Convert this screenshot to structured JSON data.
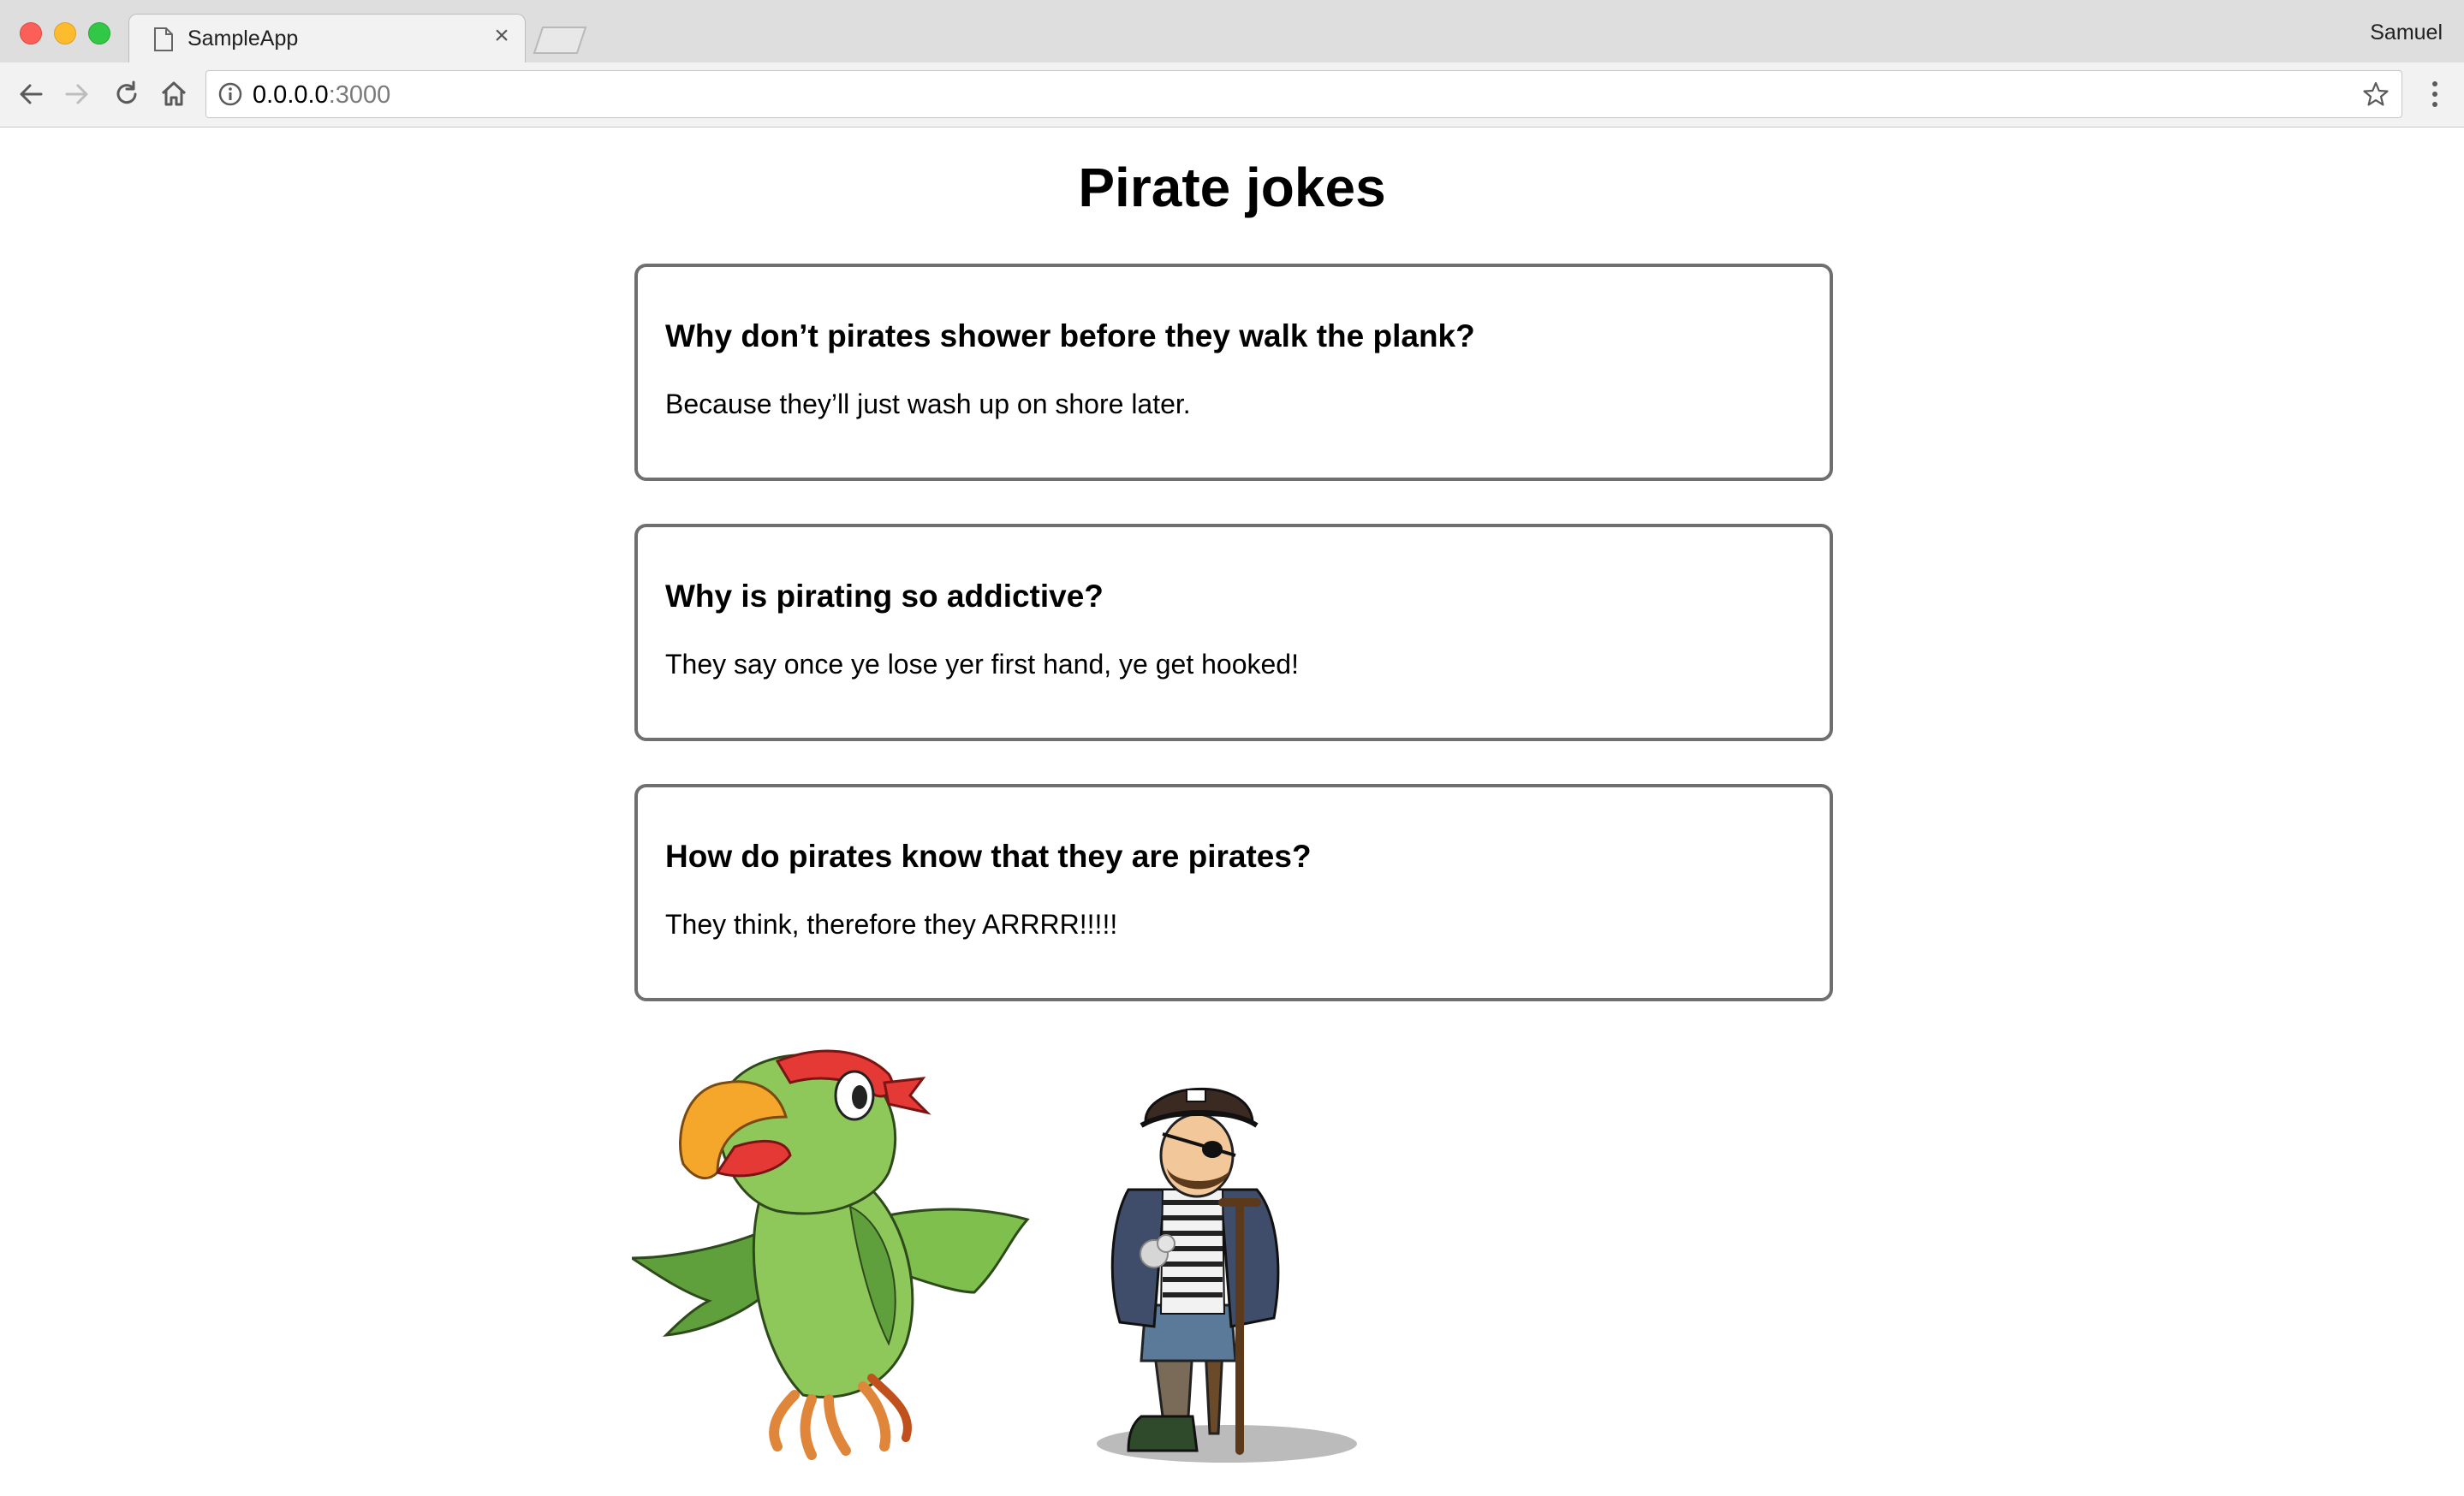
{
  "browser": {
    "tab_title": "SampleApp",
    "tab_close": "×",
    "profile_name": "Samuel",
    "url_host": "0.0.0.0",
    "url_port": ":3000"
  },
  "page": {
    "title": "Pirate jokes",
    "jokes": [
      {
        "question": "Why don’t pirates shower before they walk the plank?",
        "answer": "Because they’ll just wash up on shore later."
      },
      {
        "question": "Why is pirating so addictive?",
        "answer": "They say once ye lose yer first hand, ye get hooked!"
      },
      {
        "question": "How do pirates know that they are pirates?",
        "answer": "They think, therefore they ARRRR!!!!!"
      }
    ],
    "images": [
      {
        "name": "parrot-illustration"
      },
      {
        "name": "pirate-illustration"
      }
    ]
  },
  "colors": {
    "card_border": "#6f6f6f",
    "parrot_green": "#7cb342",
    "bandana_red": "#e53935",
    "beak_orange": "#f4a72a"
  }
}
